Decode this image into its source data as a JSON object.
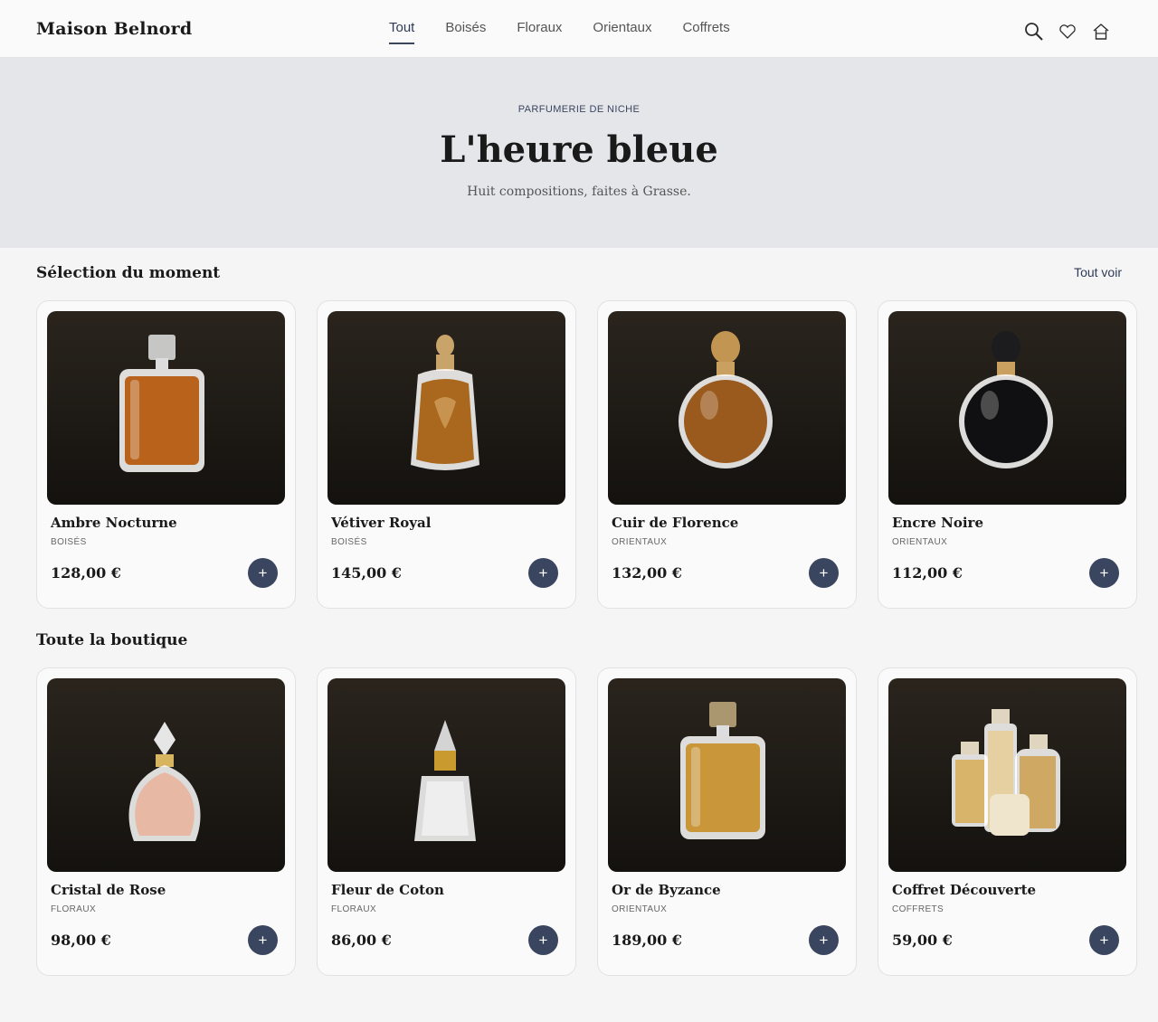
{
  "brand": "Maison Belnord",
  "nav": [
    {
      "label": "Tout",
      "active": true
    },
    {
      "label": "Boisés",
      "active": false
    },
    {
      "label": "Floraux",
      "active": false
    },
    {
      "label": "Orientaux",
      "active": false
    },
    {
      "label": "Coffrets",
      "active": false
    }
  ],
  "header_icons": [
    "search-icon",
    "heart-icon",
    "home-icon"
  ],
  "hero": {
    "kicker": "PARFUMERIE DE NICHE",
    "title": "L'heure bleue",
    "subtitle": "Huit compositions, faites à Grasse."
  },
  "featured": {
    "title": "Sélection du moment",
    "see_all": "Tout voir",
    "products": [
      {
        "name": "Ambre Nocturne",
        "category": "BOISÉS",
        "price": "128,00 €",
        "bottle": "square",
        "liquid": "#b8621c",
        "cap": "#d8d8d8"
      },
      {
        "name": "Vétiver Royal",
        "category": "BOISÉS",
        "price": "145,00 €",
        "bottle": "ornate",
        "liquid": "#a9681e",
        "cap": "#c9a46a"
      },
      {
        "name": "Cuir de Florence",
        "category": "ORIENTAUX",
        "price": "132,00 €",
        "bottle": "round",
        "liquid": "#9a5a1e",
        "cap": "#c39552"
      },
      {
        "name": "Encre Noire",
        "category": "ORIENTAUX",
        "price": "112,00 €",
        "bottle": "round",
        "liquid": "#101012",
        "cap": "#1c1c1e"
      }
    ]
  },
  "catalog": {
    "title": "Toute la boutique",
    "products": [
      {
        "name": "Cristal de Rose",
        "category": "FLORAUX",
        "price": "98,00 €",
        "bottle": "teardrop",
        "liquid": "#e7b9a4",
        "cap": "#e6e6e6"
      },
      {
        "name": "Fleur de Coton",
        "category": "FLORAUX",
        "price": "86,00 €",
        "bottle": "crystal",
        "liquid": "#eeeeee",
        "cap": "#d4d4d4"
      },
      {
        "name": "Or de Byzance",
        "category": "ORIENTAUX",
        "price": "189,00 €",
        "bottle": "square",
        "liquid": "#c9963a",
        "cap": "#b9a47a"
      },
      {
        "name": "Coffret Découverte",
        "category": "COFFRETS",
        "price": "59,00 €",
        "bottle": "set",
        "liquid": "#d8b36a",
        "cap": "#e0d6bf"
      }
    ]
  },
  "add_label": "+"
}
